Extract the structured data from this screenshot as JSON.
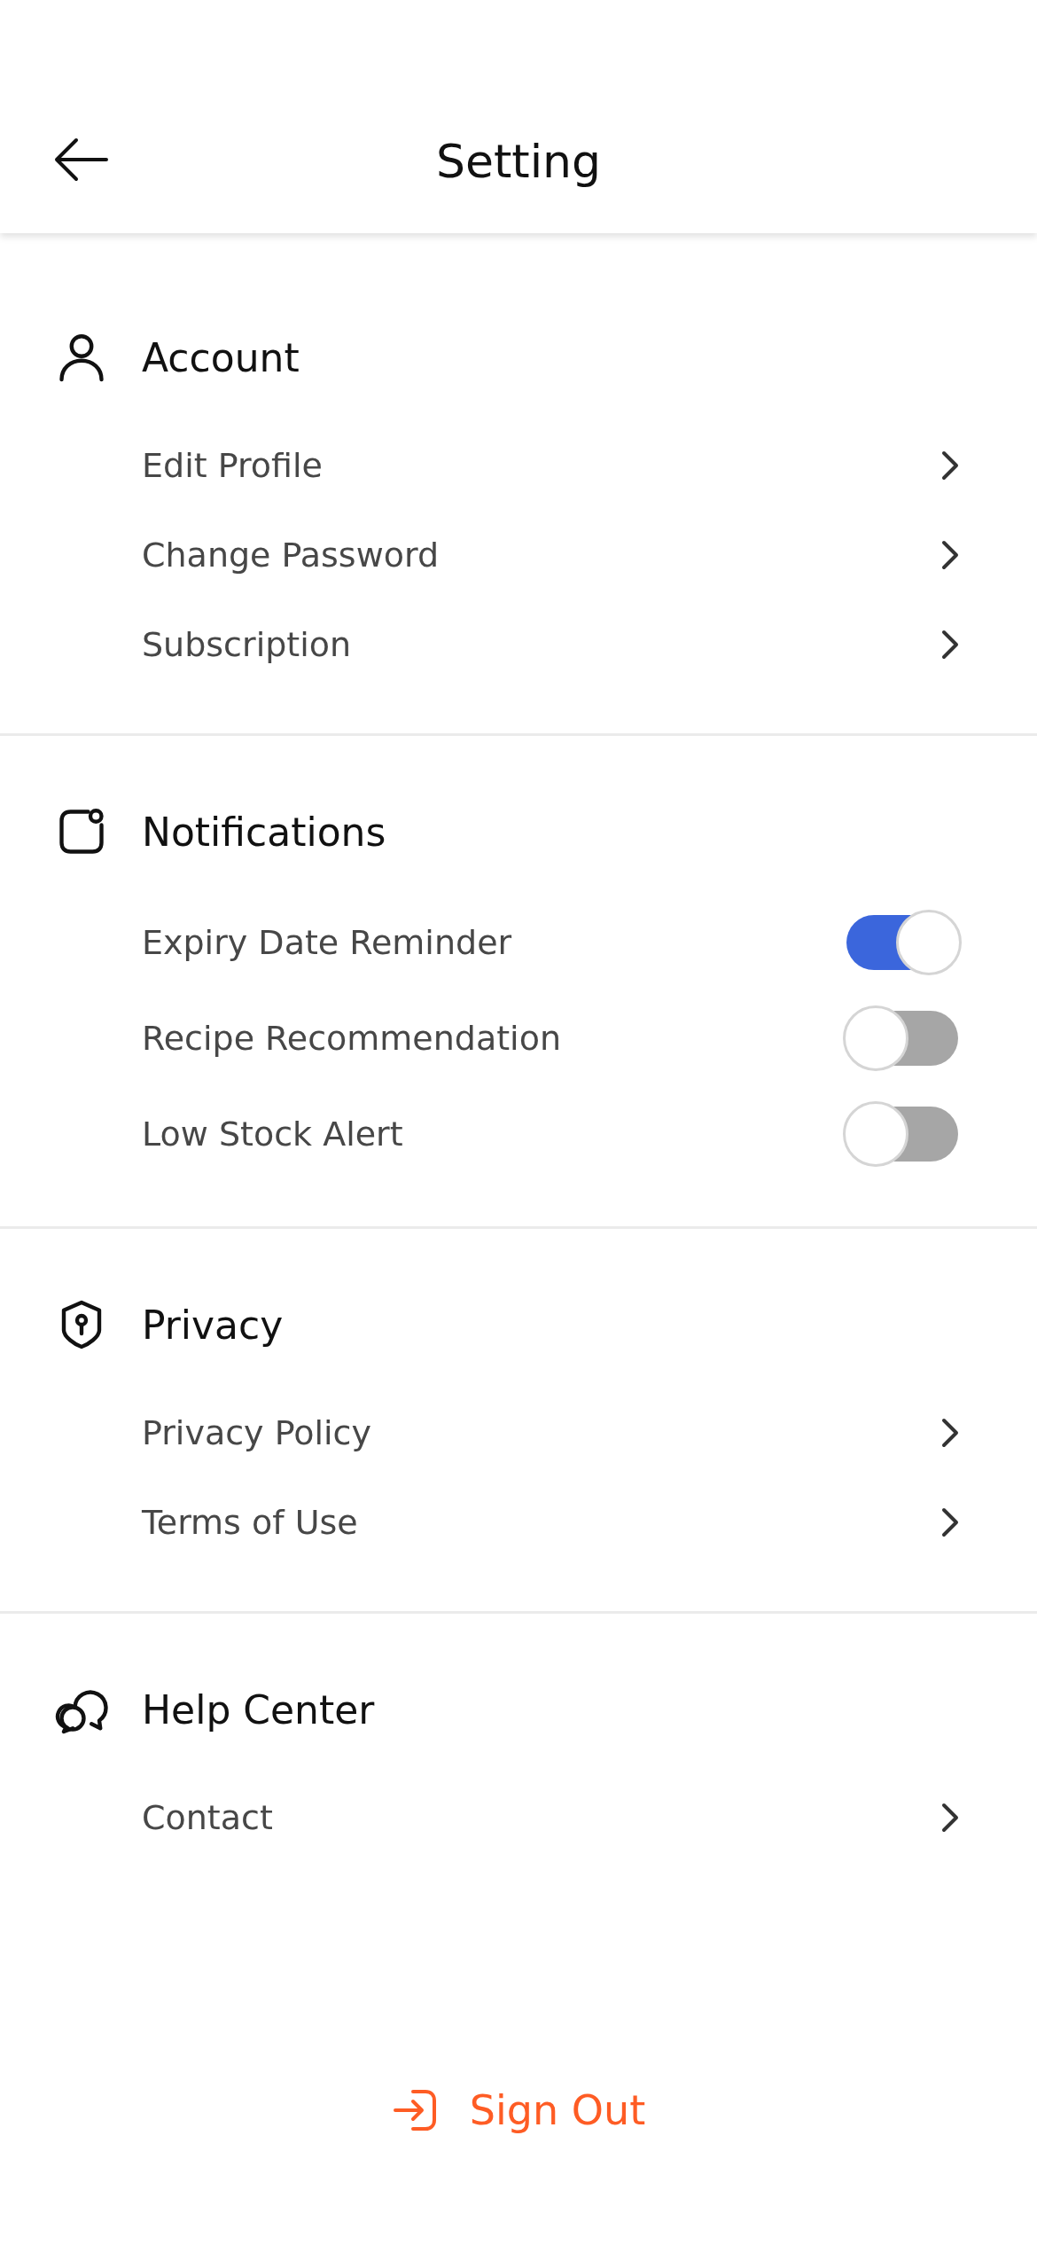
{
  "header": {
    "title": "Setting"
  },
  "sections": [
    {
      "title": "Account",
      "items": [
        {
          "kind": "link",
          "label": "Edit Profile"
        },
        {
          "kind": "link",
          "label": "Change Password"
        },
        {
          "kind": "link",
          "label": "Subscription"
        }
      ]
    },
    {
      "title": "Notifications",
      "items": [
        {
          "kind": "toggle",
          "label": "Expiry Date Reminder",
          "on": true
        },
        {
          "kind": "toggle",
          "label": "Recipe Recommendation",
          "on": false
        },
        {
          "kind": "toggle",
          "label": "Low Stock Alert",
          "on": false
        }
      ]
    },
    {
      "title": "Privacy",
      "items": [
        {
          "kind": "link",
          "label": "Privacy Policy"
        },
        {
          "kind": "link",
          "label": "Terms of Use"
        }
      ]
    },
    {
      "title": "Help Center",
      "items": [
        {
          "kind": "link",
          "label": "Contact"
        }
      ]
    }
  ],
  "sign_out": {
    "label": "Sign Out"
  }
}
